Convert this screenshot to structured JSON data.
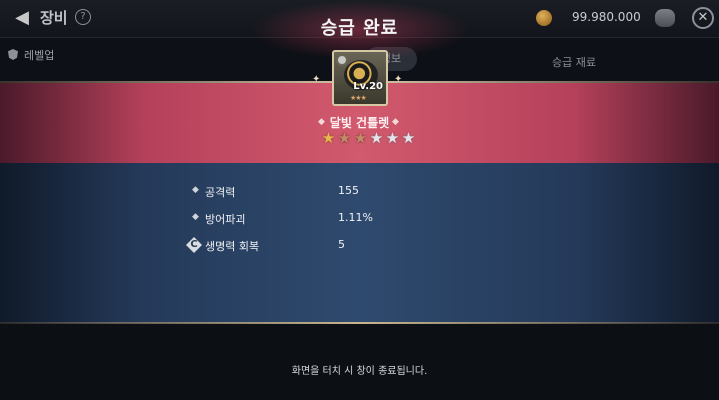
{
  "background": {
    "title": "장비",
    "gold": "99.980.000",
    "tab_levelup": "레벨업",
    "info_tab": "정보",
    "material_label": "승급 재료"
  },
  "modal": {
    "title": "승급 완료",
    "item": {
      "name": "달빛 건틀렛",
      "level": "Lv.20",
      "stars_total": 6,
      "stars_filled": 3
    },
    "stats": [
      {
        "label": "공격력",
        "value": "155",
        "marker": "bullet"
      },
      {
        "label": "방어파괴",
        "value": "1.11%",
        "marker": "bullet"
      },
      {
        "label": "생명력 회복",
        "value": "5",
        "marker": "C"
      }
    ],
    "hint": "화면을 터치 시 창이 종료됩니다."
  }
}
